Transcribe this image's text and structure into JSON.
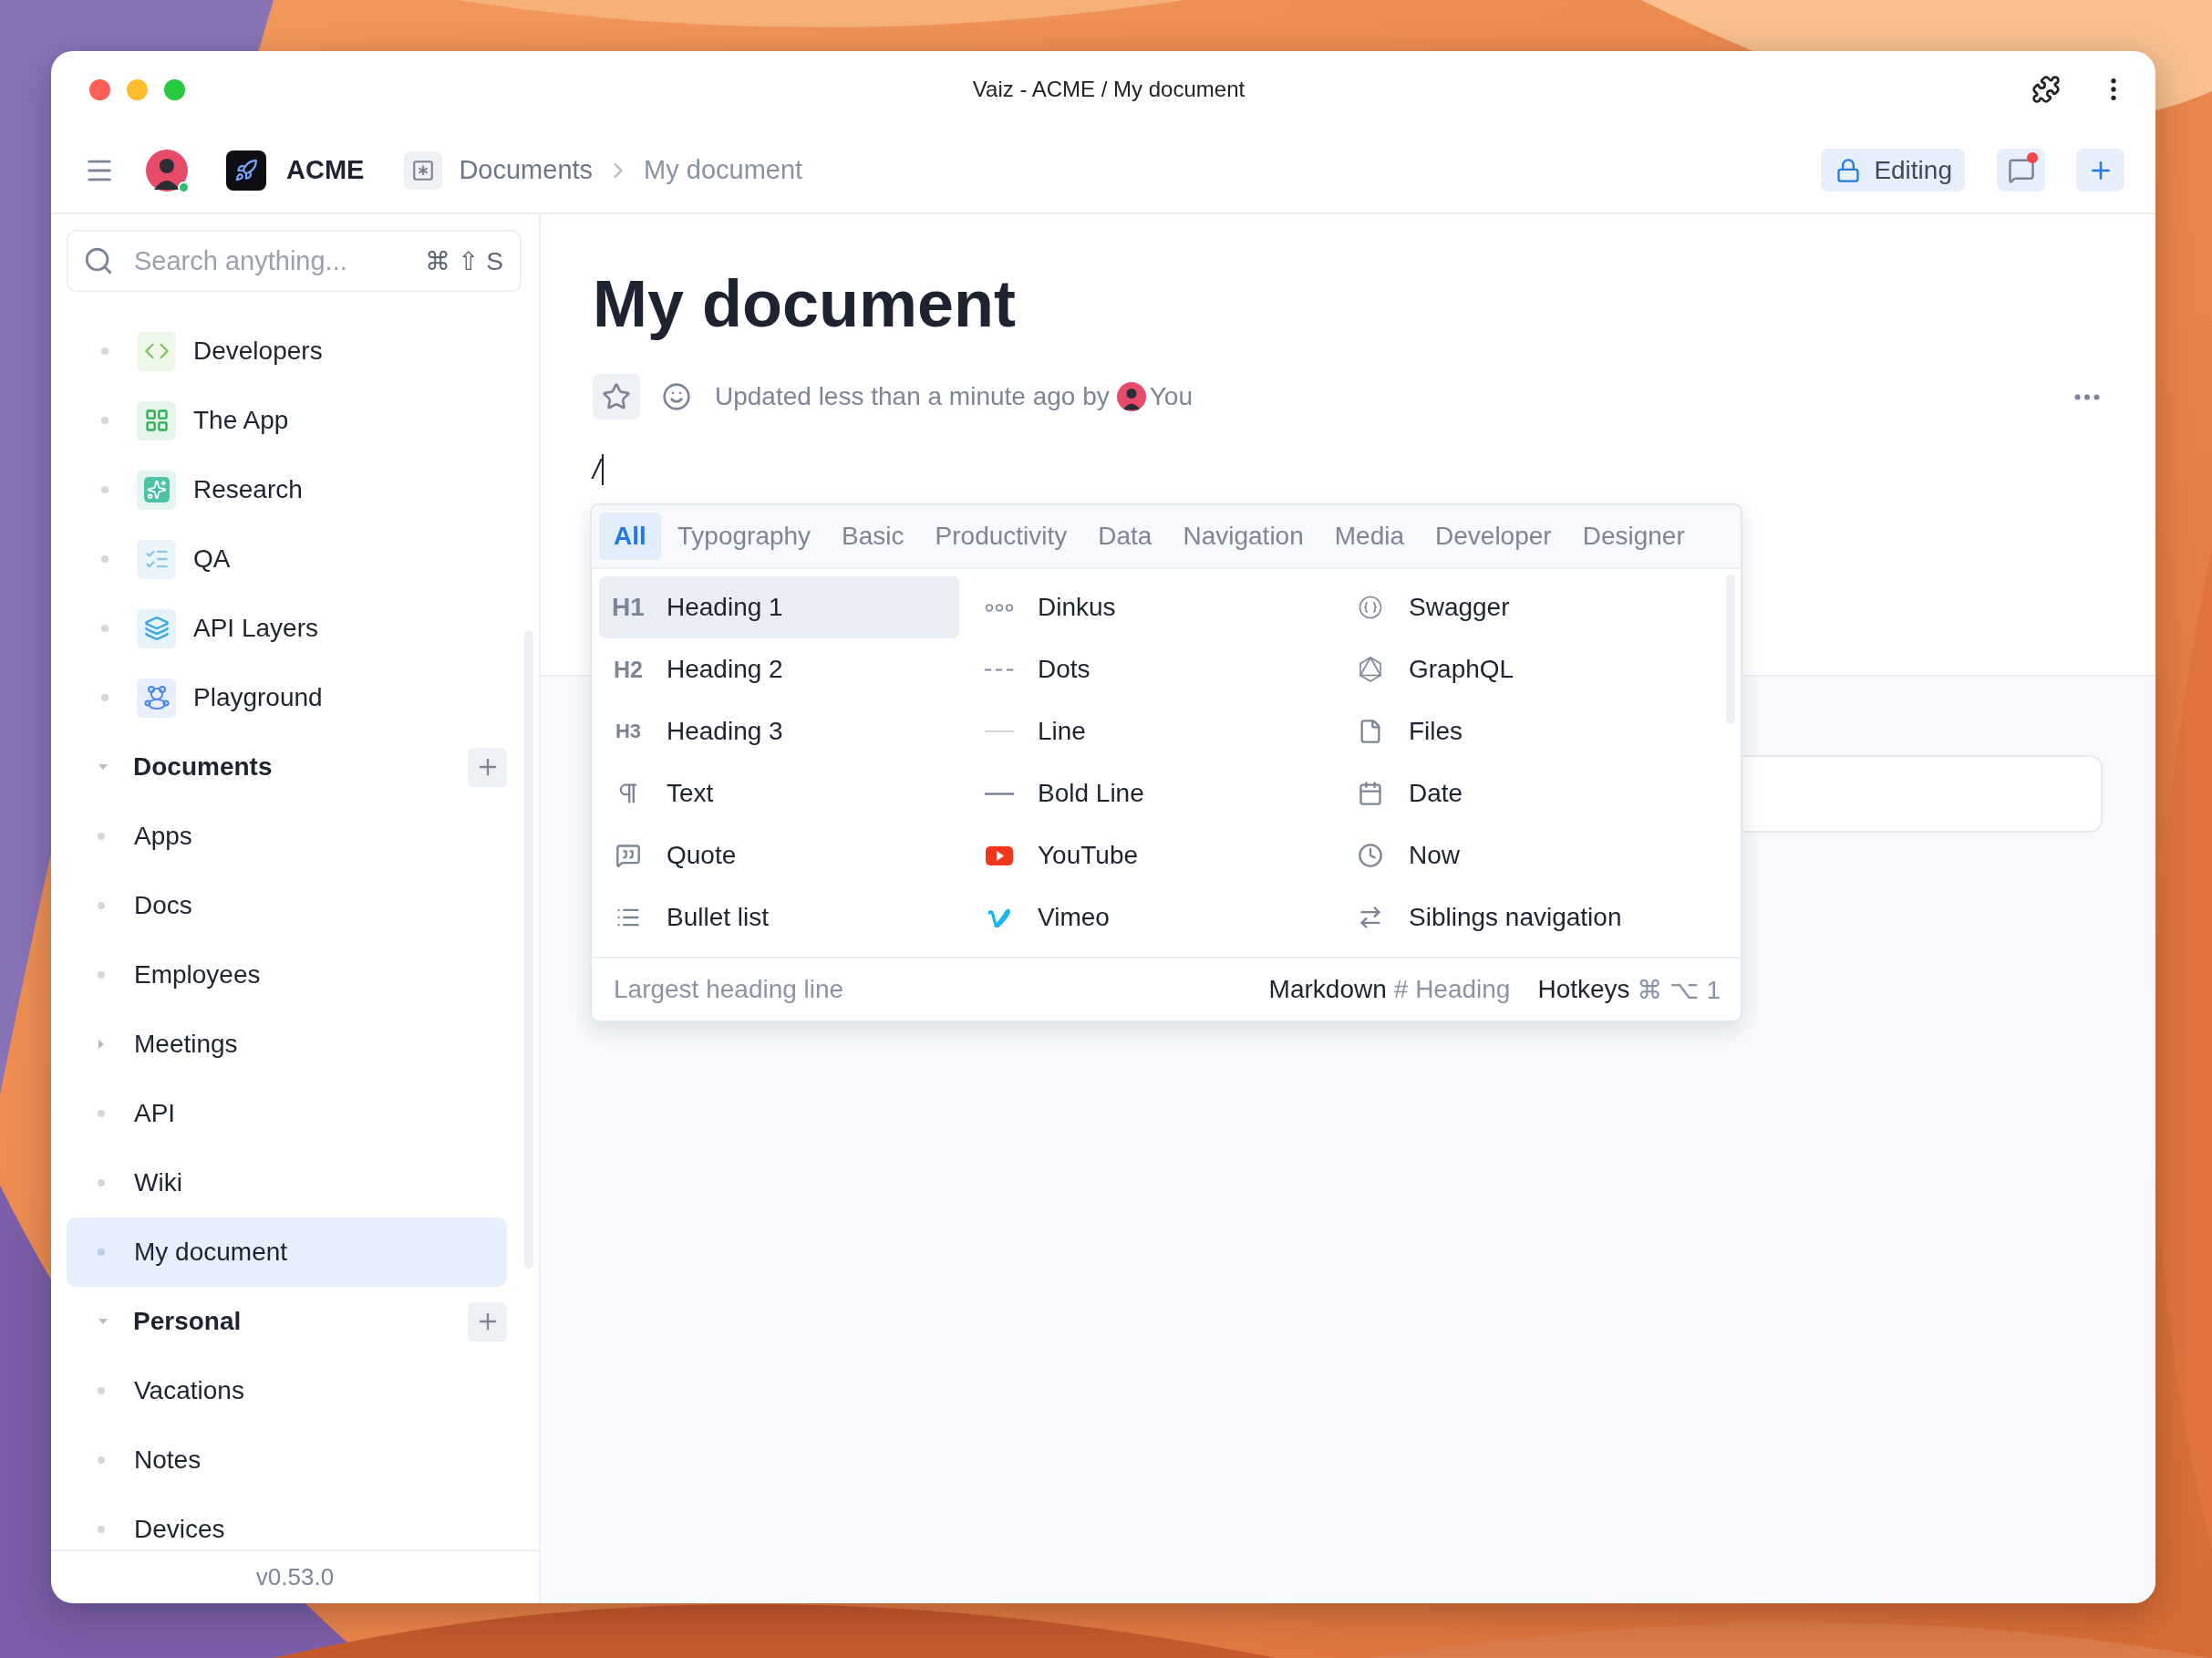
{
  "window": {
    "title": "Vaiz - ACME / My document"
  },
  "toolbar": {
    "workspace": "ACME",
    "breadcrumb": [
      {
        "label": "Documents",
        "current": false
      },
      {
        "label": "My document",
        "current": true
      }
    ],
    "editing_button": "Editing",
    "comments": {
      "unread": true
    }
  },
  "sidebar": {
    "search": {
      "placeholder": "Search anything...",
      "shortcut": "⌘ ⇧ S"
    },
    "spaces": [
      {
        "label": "Developers",
        "selected": false
      },
      {
        "label": "The App",
        "selected": false
      },
      {
        "label": "Research",
        "selected": false
      },
      {
        "label": "QA",
        "selected": false
      },
      {
        "label": "API Layers",
        "selected": false
      },
      {
        "label": "Playground",
        "selected": false
      }
    ],
    "sections": [
      {
        "label": "Documents",
        "expanded": true,
        "children": [
          {
            "label": "Apps",
            "kind": "page",
            "selected": false
          },
          {
            "label": "Docs",
            "kind": "page",
            "selected": false
          },
          {
            "label": "Employees",
            "kind": "page",
            "selected": false
          },
          {
            "label": "Meetings",
            "kind": "folder",
            "expanded": false,
            "selected": false
          },
          {
            "label": "API",
            "kind": "page",
            "selected": false
          },
          {
            "label": "Wiki",
            "kind": "page",
            "selected": false
          },
          {
            "label": "My document",
            "kind": "page",
            "selected": true
          }
        ]
      },
      {
        "label": "Personal",
        "expanded": true,
        "children": [
          {
            "label": "Vacations",
            "kind": "page",
            "selected": false
          },
          {
            "label": "Notes",
            "kind": "page",
            "selected": false
          },
          {
            "label": "Devices",
            "kind": "page",
            "selected": false
          }
        ]
      }
    ],
    "version": "v0.53.0"
  },
  "document": {
    "title": "My document",
    "starred": false,
    "updated": "Updated less than a minute ago by",
    "author": "You",
    "body": "/"
  },
  "slash_menu": {
    "tabs": [
      {
        "label": "All",
        "selected": true
      },
      {
        "label": "Typography",
        "selected": false
      },
      {
        "label": "Basic",
        "selected": false
      },
      {
        "label": "Productivity",
        "selected": false
      },
      {
        "label": "Data",
        "selected": false
      },
      {
        "label": "Navigation",
        "selected": false
      },
      {
        "label": "Media",
        "selected": false
      },
      {
        "label": "Developer",
        "selected": false
      },
      {
        "label": "Designer",
        "selected": false
      }
    ],
    "columns": [
      [
        {
          "label": "Heading 1",
          "badge": "H1",
          "selected": true
        },
        {
          "label": "Heading 2",
          "badge": "H2",
          "selected": false
        },
        {
          "label": "Heading 3",
          "badge": "H3",
          "selected": false
        },
        {
          "label": "Text",
          "selected": false
        },
        {
          "label": "Quote",
          "selected": false
        },
        {
          "label": "Bullet list",
          "selected": false
        }
      ],
      [
        {
          "label": "Dinkus",
          "selected": false
        },
        {
          "label": "Dots",
          "selected": false
        },
        {
          "label": "Line",
          "selected": false
        },
        {
          "label": "Bold Line",
          "selected": false
        },
        {
          "label": "YouTube",
          "selected": false
        },
        {
          "label": "Vimeo",
          "selected": false
        }
      ],
      [
        {
          "label": "Swagger",
          "selected": false
        },
        {
          "label": "GraphQL",
          "selected": false
        },
        {
          "label": "Files",
          "selected": false
        },
        {
          "label": "Date",
          "selected": false
        },
        {
          "label": "Now",
          "selected": false
        },
        {
          "label": "Siblings navigation",
          "selected": false
        }
      ]
    ],
    "footer": {
      "description": "Largest heading line",
      "markdown_label": "Markdown",
      "markdown": "# Heading",
      "hotkeys_label": "Hotkeys",
      "hotkeys": "⌘ ⌥ 1"
    }
  }
}
